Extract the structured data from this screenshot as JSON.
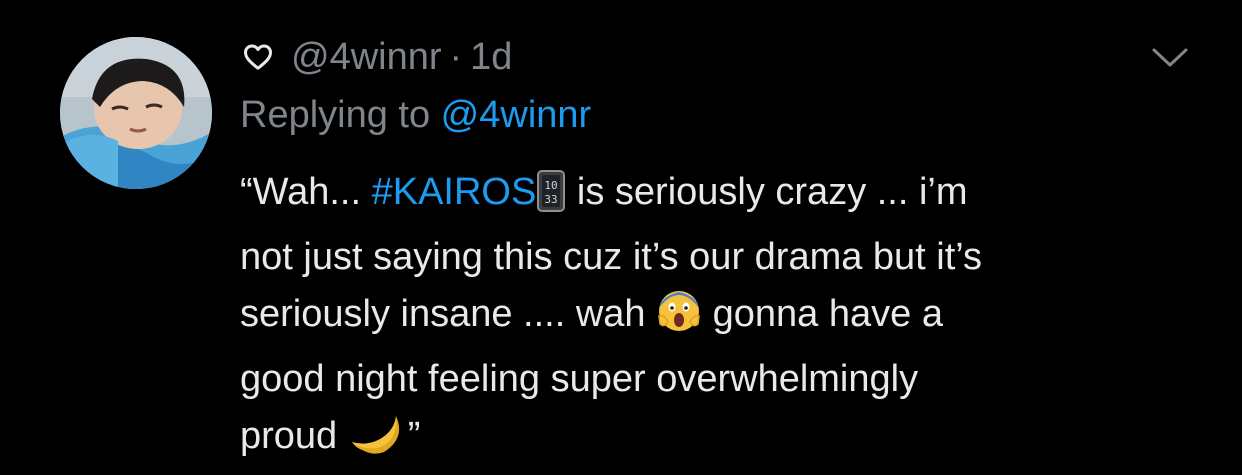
{
  "tweet": {
    "username": "@4winnr",
    "separator": "·",
    "timestamp": "1d",
    "replying_prefix": "Replying to ",
    "replying_to": "@4winnr",
    "body": {
      "line1_a": "“Wah... ",
      "hashtag": "#KAIROS",
      "line1_b": " is seriously crazy ... i’m",
      "line2": "not just saying this cuz it’s our drama but it’s",
      "line3_a": "seriously insane .... wah ",
      "line3_b": " gonna have a",
      "line4": "good night feeling super overwhelmingly",
      "line5_a": "proud ",
      "line5_b": "”"
    },
    "icons": {
      "like": "heart-outline-icon",
      "menu": "chevron-down-icon",
      "clock_emoji": "digital-clock-emoji-icon",
      "scream_emoji": "screaming-face-emoji-icon",
      "moon_emoji": "crescent-moon-emoji-icon"
    },
    "colors": {
      "background": "#000000",
      "text": "#e7e9ea",
      "muted": "#7f858a",
      "link": "#1d9bf0"
    }
  }
}
